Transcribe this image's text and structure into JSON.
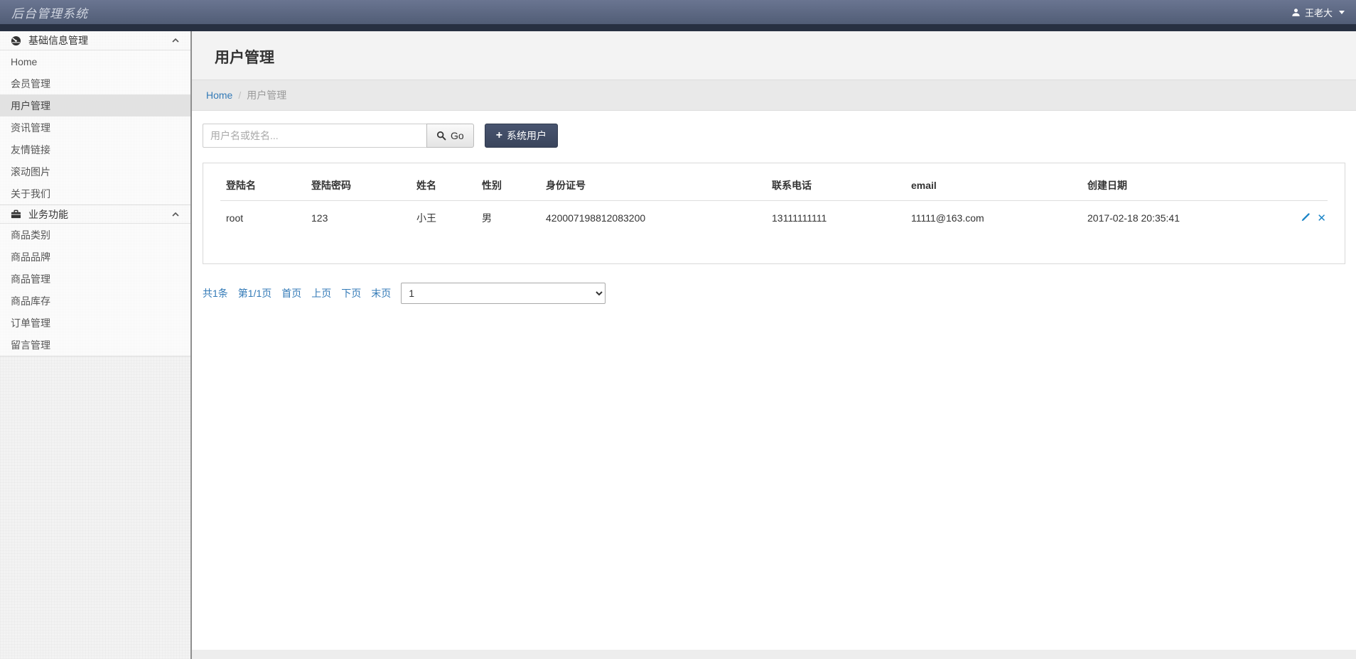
{
  "topbar": {
    "title": "后台管理系统",
    "user": "王老大",
    "user_icon": "user-icon",
    "caret_icon": "caret-down-icon"
  },
  "sidebar": {
    "sections": [
      {
        "label": "基础信息管理",
        "icon": "dashboard-icon",
        "chevron": "chevron-up-icon",
        "items": [
          "Home",
          "会员管理",
          "用户管理",
          "资讯管理",
          "友情链接",
          "滚动图片",
          "关于我们"
        ]
      },
      {
        "label": "业务功能",
        "icon": "briefcase-icon",
        "chevron": "chevron-up-icon",
        "items": [
          "商品类别",
          "商品品牌",
          "商品管理",
          "商品库存",
          "订单管理",
          "留言管理"
        ]
      }
    ],
    "active_item": "用户管理"
  },
  "page": {
    "title": "用户管理",
    "breadcrumb": {
      "home": "Home",
      "separator": "/",
      "current": "用户管理"
    }
  },
  "search": {
    "placeholder": "用户名或姓名...",
    "go_label": "Go",
    "go_icon": "search-icon",
    "plus": "+",
    "add_user_label": "系统用户"
  },
  "table": {
    "headers": [
      "登陆名",
      "登陆密码",
      "姓名",
      "性别",
      "身份证号",
      "联系电话",
      "email",
      "创建日期"
    ],
    "rows": [
      {
        "login": "root",
        "password": "123",
        "name": "小王",
        "gender": "男",
        "id_number": "420007198812083200",
        "phone": "13111111111",
        "email": "11111@163.com",
        "created": "2017-02-18 20:35:41"
      }
    ],
    "row_action_icons": [
      "edit-pencil-icon",
      "delete-x-icon"
    ],
    "delete_glyph": "✕"
  },
  "pagination": {
    "total": "共1条",
    "page_info": "第1/1页",
    "first": "首页",
    "prev": "上页",
    "next": "下页",
    "last": "末页",
    "page_select": {
      "selected": "1",
      "options": [
        "1"
      ]
    }
  },
  "colors": {
    "accent_blue": "#337ab7",
    "action_icon_blue": "#1c85c7",
    "topbar_gradient_top": "#6a7591",
    "topbar_gradient_bottom": "#515d76",
    "topbar_shadow": "#273041",
    "dark_button": "#3f4a63",
    "active_item_bg": "#e2e2e2"
  }
}
